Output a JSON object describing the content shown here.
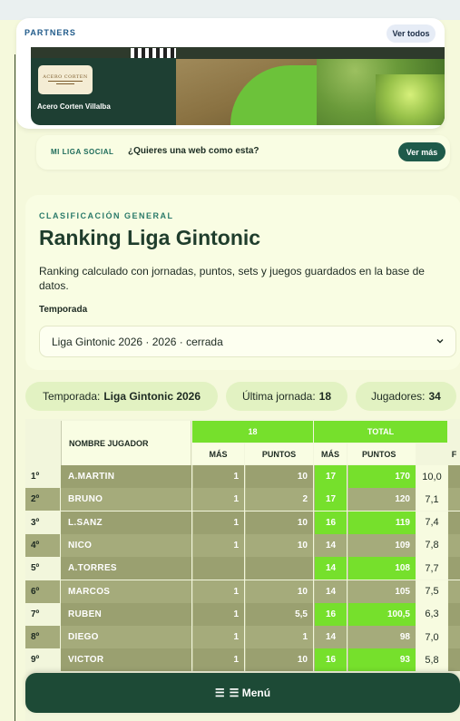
{
  "partners": {
    "title": "PARTNERS",
    "ver_todos": "Ver todos",
    "banner": {
      "brand_name": "Acero Corten Villalba",
      "logo_text": "ACERO CORTEN"
    }
  },
  "social": {
    "tag": "MI LIGA SOCIAL",
    "question": "¿Quieres una web como esta?",
    "button": "Ver más"
  },
  "ranking": {
    "kicker": "CLASIFICACIÓN GENERAL",
    "title": "Ranking Liga Gintonic",
    "description": "Ranking calculado con jornadas, puntos, sets y juegos guardados en la base de datos.",
    "season_label": "Temporada",
    "season_value": "Liga Gintonic 2026 · 2026 · cerrada"
  },
  "stats": [
    {
      "label": "Temporada:",
      "value": "Liga Gintonic 2026"
    },
    {
      "label": "Última jornada:",
      "value": "18"
    },
    {
      "label": "Jugadores:",
      "value": "34"
    }
  ],
  "table": {
    "name_header": "NOMBRE JUGADOR",
    "group_18": "18",
    "group_total": "TOTAL",
    "sub_mas": "MÁS",
    "sub_puntos": "PUNTOS",
    "sub_mas_total": "MÁS",
    "sub_puntos_total": "PUNTOS",
    "sub_extra": "F",
    "rows": [
      {
        "pos": "1º",
        "name": "A.MARTIN",
        "j_mas": "1",
        "j_pts": "10",
        "t_mas": "17",
        "t_pts": "170",
        "avg": "10,0"
      },
      {
        "pos": "2º",
        "name": "BRUNO",
        "j_mas": "1",
        "j_pts": "2",
        "t_mas": "17",
        "t_pts": "120",
        "avg": "7,1"
      },
      {
        "pos": "3º",
        "name": "L.SANZ",
        "j_mas": "1",
        "j_pts": "10",
        "t_mas": "16",
        "t_pts": "119",
        "avg": "7,4"
      },
      {
        "pos": "4º",
        "name": "NICO",
        "j_mas": "1",
        "j_pts": "10",
        "t_mas": "14",
        "t_pts": "109",
        "avg": "7,8"
      },
      {
        "pos": "5º",
        "name": "A.TORRES",
        "j_mas": "",
        "j_pts": "",
        "t_mas": "14",
        "t_pts": "108",
        "avg": "7,7"
      },
      {
        "pos": "6º",
        "name": "MARCOS",
        "j_mas": "1",
        "j_pts": "10",
        "t_mas": "14",
        "t_pts": "105",
        "avg": "7,5"
      },
      {
        "pos": "7º",
        "name": "RUBEN",
        "j_mas": "1",
        "j_pts": "5,5",
        "t_mas": "16",
        "t_pts": "100,5",
        "avg": "6,3"
      },
      {
        "pos": "8º",
        "name": "DIEGO",
        "j_mas": "1",
        "j_pts": "1",
        "t_mas": "14",
        "t_pts": "98",
        "avg": "7,0"
      },
      {
        "pos": "9º",
        "name": "VICTOR",
        "j_mas": "1",
        "j_pts": "10",
        "t_mas": "16",
        "t_pts": "93",
        "avg": "5,8"
      }
    ]
  },
  "menu": {
    "label": "☰ Menú"
  },
  "colors": {
    "accent_green": "#76e02c",
    "dark_green": "#1d4a36",
    "row_olive": "#a5ab7b",
    "row_olive_dark": "#9aa070"
  }
}
